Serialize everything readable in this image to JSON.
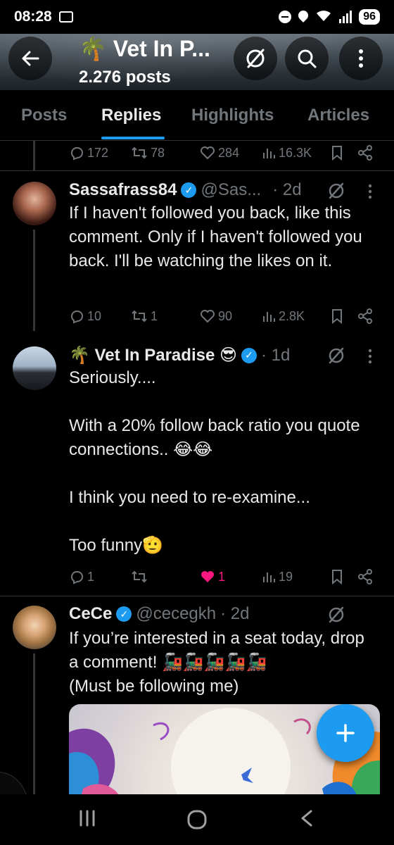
{
  "status_bar": {
    "time": "08:28",
    "battery": "96",
    "network": "6"
  },
  "header": {
    "title": "🌴 Vet In P...",
    "subtitle": "2.276 posts"
  },
  "tabs": [
    {
      "label": "Posts",
      "active": false
    },
    {
      "label": "Replies",
      "active": true
    },
    {
      "label": "Highlights",
      "active": false
    },
    {
      "label": "Articles",
      "active": false
    }
  ],
  "top_actions": {
    "replies": "172",
    "reposts": "78",
    "likes": "284",
    "views": "16.3K"
  },
  "tweets": [
    {
      "name": "Sassafrass84",
      "handle": "@Sas...",
      "time": "· 2d",
      "text": "If I haven't followed you back, like this comment. Only if I haven't followed you back. I'll be watching the likes on it.",
      "replies": "10",
      "reposts": "1",
      "likes": "90",
      "views": "2.8K"
    },
    {
      "name": "🌴 Vet In Paradise 😎",
      "handle": "",
      "time": "· 1d",
      "text": "Seriously....\n\nWith a 20% follow back ratio you quote connections.. 😂😂\n\nI think you need to re-examine...\n\nToo funny🫡",
      "replies": "1",
      "reposts": "",
      "likes": "1",
      "views": "19"
    },
    {
      "name": "CeCe",
      "handle": "@cecegkh",
      "time": "· 2d",
      "text": "If you’re interested in a seat today, drop a comment! 🚂🚂🚂🚂🚂\n(Must be following me)"
    }
  ],
  "colors": {
    "accent": "#1d9bf0",
    "like": "#f91880",
    "muted": "#71767b",
    "background": "#000000"
  }
}
